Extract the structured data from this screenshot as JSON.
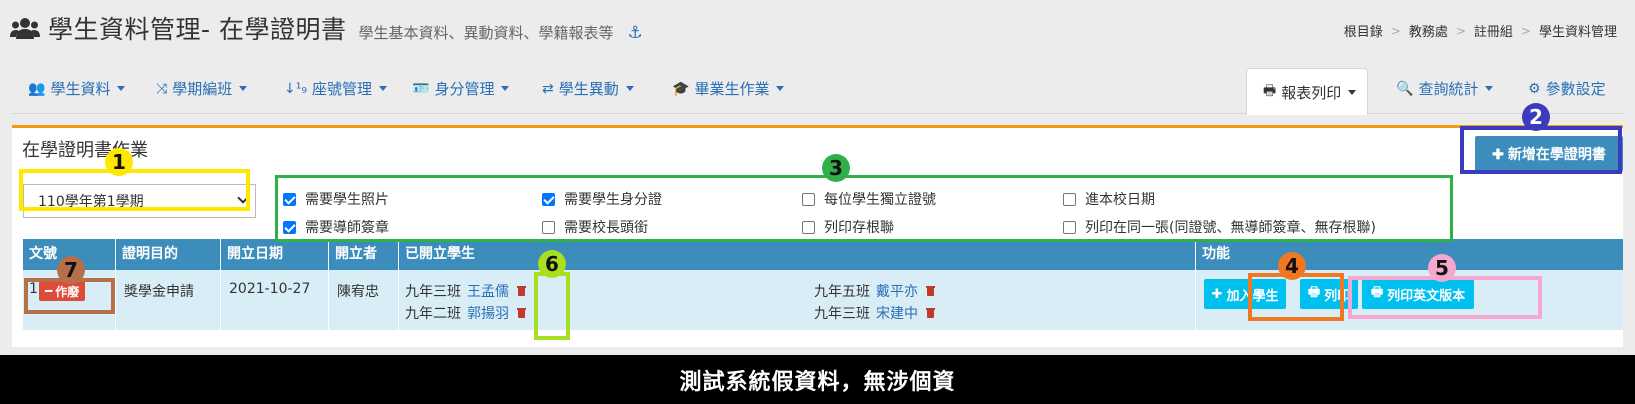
{
  "header": {
    "title": "學生資料管理- 在學證明書",
    "subtitle": "學生基本資料、異動資料、學籍報表等",
    "title_icon": "users-icon",
    "anchor_icon": "anchor-icon",
    "breadcrumb": [
      "根目錄",
      "教務處",
      "註冊組",
      "學生資料管理"
    ]
  },
  "nav": {
    "items": [
      {
        "label": "學生資料",
        "icon": "users-icon"
      },
      {
        "label": "學期編班",
        "icon": "shuffle-icon"
      },
      {
        "label": "座號管理",
        "icon": "sort-numeric-icon"
      },
      {
        "label": "身分管理",
        "icon": "id-card-icon"
      },
      {
        "label": "學生異動",
        "icon": "exchange-icon"
      },
      {
        "label": "畢業生作業",
        "icon": "graduation-cap-icon"
      }
    ],
    "right_items": [
      {
        "label": "報表列印",
        "icon": "print-icon",
        "active": true
      },
      {
        "label": "查詢統計",
        "icon": "search-icon"
      },
      {
        "label": "參數設定",
        "icon": "gear-icon"
      }
    ]
  },
  "panel": {
    "title": "在學證明書作業",
    "add_button": "新增在學證明書",
    "semester": "110學年第1學期",
    "options": [
      {
        "label": "需要學生照片",
        "checked": true
      },
      {
        "label": "需要學生身分證",
        "checked": true
      },
      {
        "label": "每位學生獨立證號",
        "checked": false
      },
      {
        "label": "進本校日期",
        "checked": false
      },
      {
        "label": "需要導師簽章",
        "checked": true
      },
      {
        "label": "需要校長頭銜",
        "checked": false
      },
      {
        "label": "列印存根聯",
        "checked": false
      },
      {
        "label": "列印在同一張(同證號、無導師簽章、無存根聯)",
        "checked": false
      }
    ]
  },
  "table": {
    "headers": [
      "文號",
      "證明目的",
      "開立日期",
      "開立者",
      "已開立學生",
      "功能"
    ],
    "rows": [
      {
        "no": "1",
        "void_label": "作廢",
        "purpose": "獎學金申請",
        "date": "2021-10-27",
        "issuer": "陳宥忠",
        "students_left": [
          {
            "class": "九年三班",
            "name": "王孟儒"
          },
          {
            "class": "九年二班",
            "name": "郭揚羽"
          }
        ],
        "students_right": [
          {
            "class": "九年五班",
            "name": "戴平亦"
          },
          {
            "class": "九年三班",
            "name": "宋建中"
          }
        ],
        "actions": {
          "add_student": "加入學生",
          "print": "列印",
          "print_english": "列印英文版本"
        }
      }
    ]
  },
  "annotations": [
    "1",
    "2",
    "3",
    "4",
    "5",
    "6",
    "7"
  ],
  "footer": {
    "text": "測試系統假資料，無涉個資"
  },
  "colors": {
    "primary": "#3c8dbc",
    "info": "#00c0ef",
    "danger": "#dd4b39",
    "accent": "#f39c12",
    "link": "#2a6fb5"
  }
}
